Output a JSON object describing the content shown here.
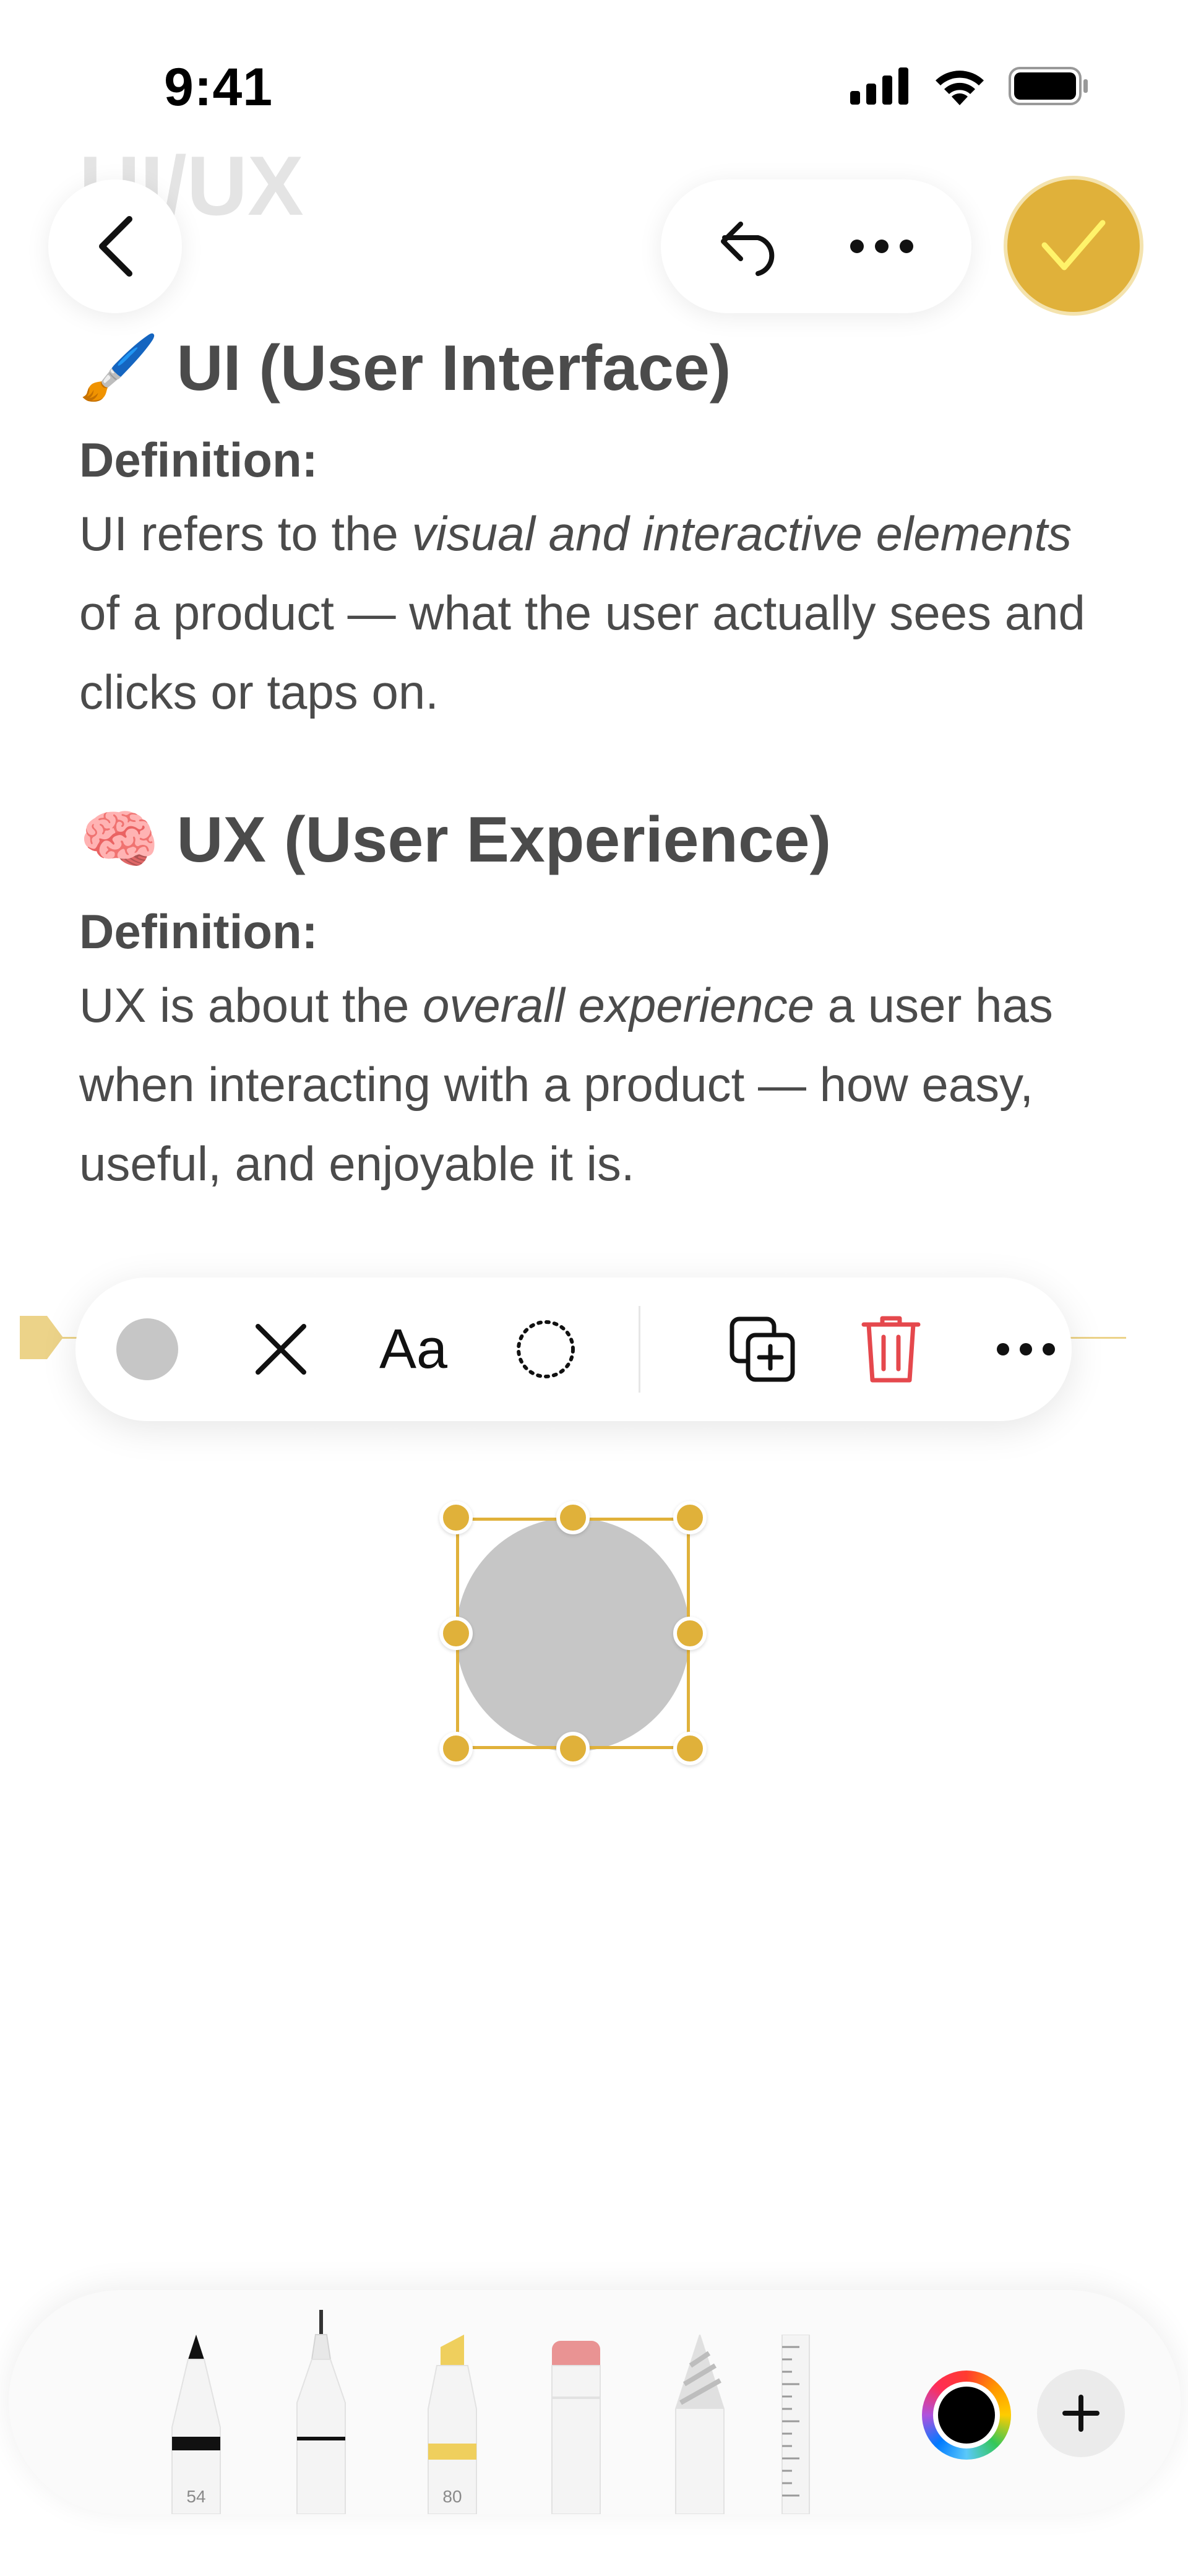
{
  "status_bar": {
    "time": "9:41"
  },
  "nav": {
    "faded_title": "UI/UX"
  },
  "document": {
    "ui_section": {
      "emoji": "🖌️",
      "title": "UI (User Interface)",
      "definition_label": "Definition:",
      "text_1": "UI refers to the ",
      "text_emphasis": "visual and interactive elements",
      "text_2": " of a product — what the user actually sees and clicks or taps on."
    },
    "ux_section": {
      "emoji": "🧠",
      "title": "UX (User Experience)",
      "definition_label": "Definition:",
      "text_1": "UX is about the ",
      "text_emphasis": "overall experience",
      "text_2": " a user has when interacting with a product — how easy, useful, and enjoyable it is."
    }
  },
  "floating_toolbar": {
    "font_button_label": "Aa",
    "fill_color": "#c6c6c6",
    "delete_color": "#e5484d"
  },
  "shape": {
    "type": "circle",
    "fill": "#c6c6c6",
    "selection_color": "#e0b13a"
  },
  "palette": {
    "pen_number": "54",
    "highlighter_number": "80",
    "current_color": "#000000"
  },
  "colors": {
    "accent": "#e0b13a",
    "text": "#4b4b4b"
  }
}
